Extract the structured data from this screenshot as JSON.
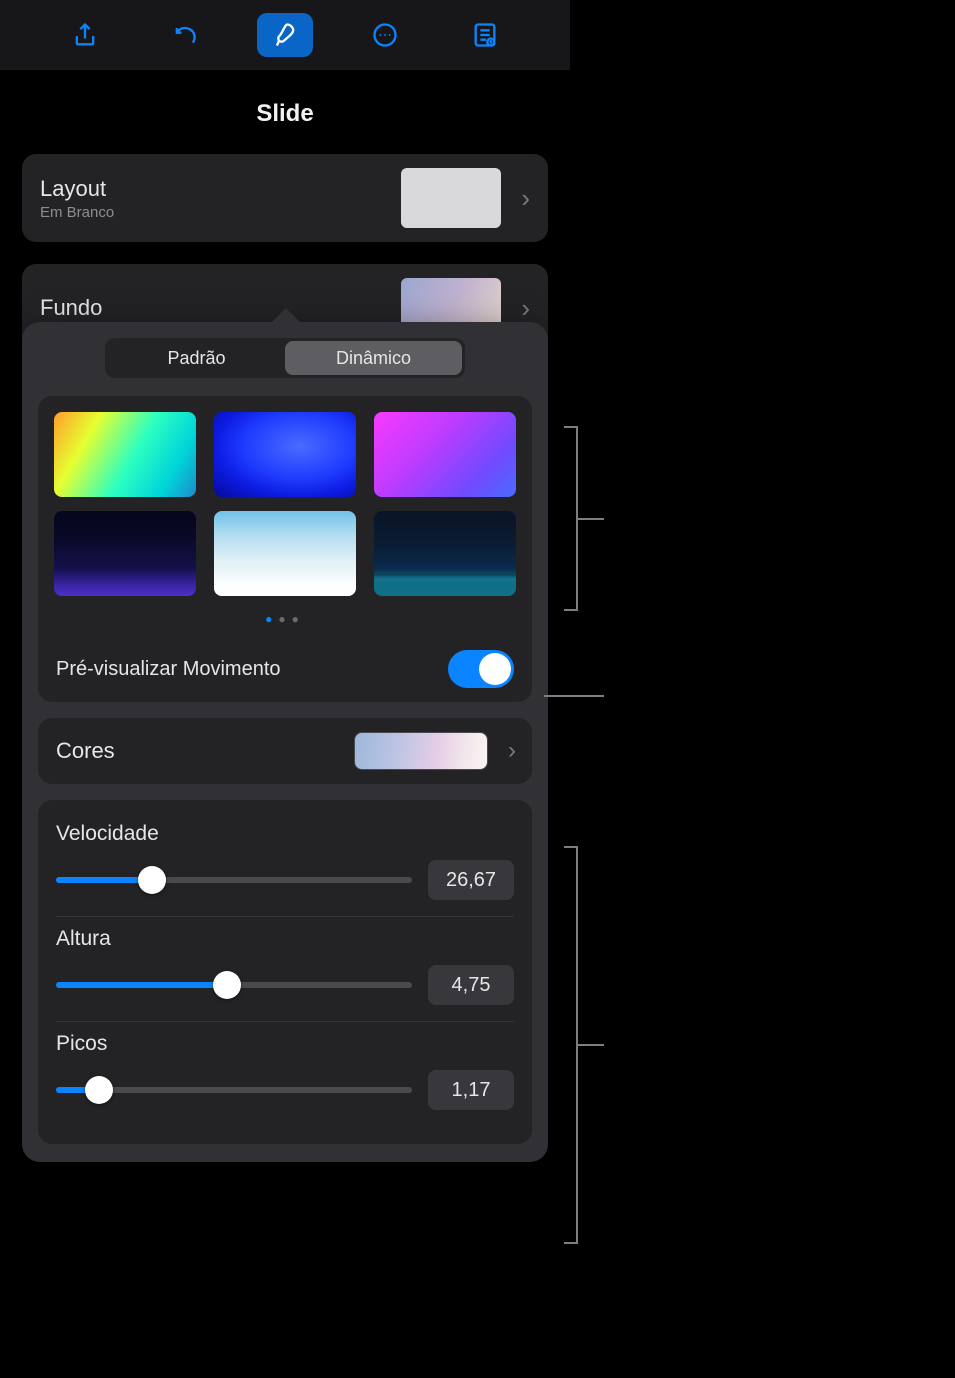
{
  "toolbar": {
    "icons": [
      "share-icon",
      "undo-icon",
      "format-brush-icon",
      "more-icon",
      "presenter-notes-icon"
    ],
    "active_index": 2
  },
  "panel": {
    "title": "Slide"
  },
  "layout_row": {
    "label": "Layout",
    "sub": "Em Branco"
  },
  "fundo_row": {
    "label": "Fundo"
  },
  "segmented": {
    "option_a": "Padrão",
    "option_b": "Dinâmico",
    "selected": "b"
  },
  "pager": {
    "dots": 3,
    "active": 0
  },
  "preview_motion": {
    "label": "Pré-visualizar Movimento",
    "on": true
  },
  "cores": {
    "label": "Cores"
  },
  "sliders": {
    "velocidade": {
      "label": "Velocidade",
      "value": "26,67",
      "percent": 27
    },
    "altura": {
      "label": "Altura",
      "value": "4,75",
      "percent": 48
    },
    "picos": {
      "label": "Picos",
      "value": "1,17",
      "percent": 12
    }
  }
}
